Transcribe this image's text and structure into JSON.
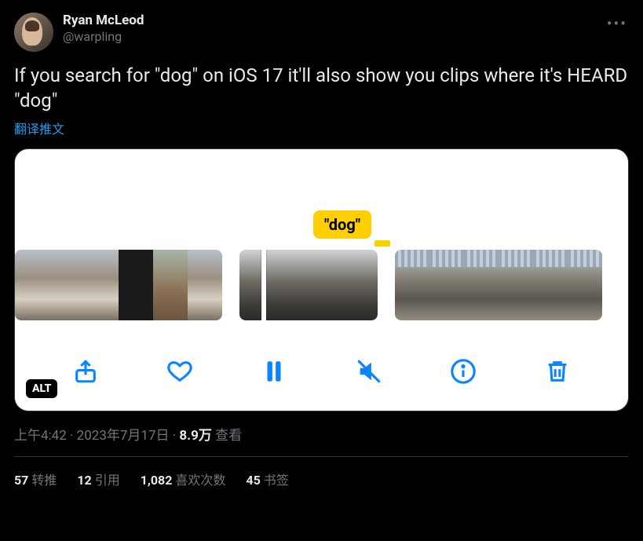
{
  "author": {
    "display_name": "Ryan McLeod",
    "handle": "@warpling"
  },
  "tweet_text": "If you search for \"dog\" on iOS 17 it'll also show you clips where it's HEARD \"dog\"",
  "translate_label": "翻译推文",
  "media": {
    "caption_tag": "\"dog\"",
    "alt_badge": "ALT",
    "toolbar_icons": {
      "share": "share-icon",
      "like": "heart-icon",
      "pause": "pause-icon",
      "mute": "speaker-muted-icon",
      "info": "info-icon",
      "delete": "trash-icon"
    }
  },
  "meta": {
    "time": "上午4:42",
    "date": "2023年7月17日",
    "views_count": "8.9万",
    "views_label": "查看",
    "separator": " · "
  },
  "stats": {
    "retweets_count": "57",
    "retweets_label": "转推",
    "quotes_count": "12",
    "quotes_label": "引用",
    "likes_count": "1,082",
    "likes_label": "喜欢次数",
    "bookmarks_count": "45",
    "bookmarks_label": "书签"
  }
}
